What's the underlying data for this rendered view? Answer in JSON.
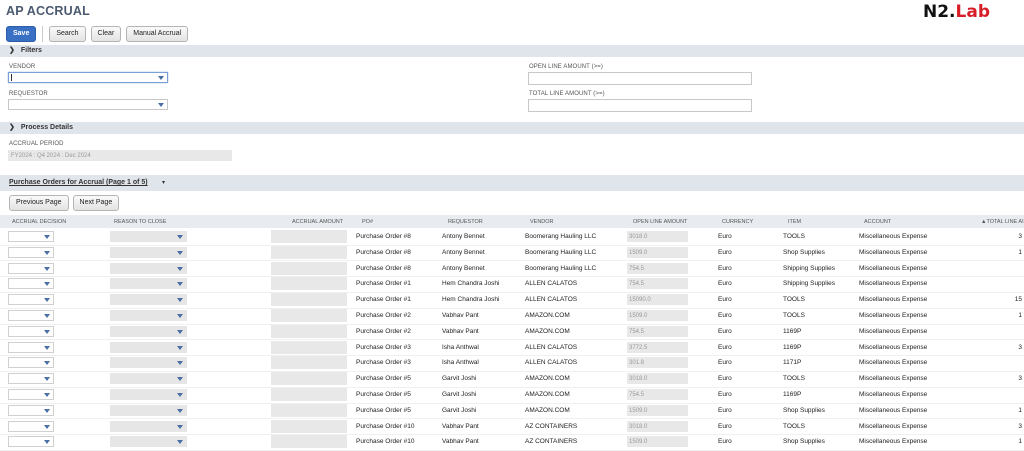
{
  "page": {
    "title": "AP ACCRUAL"
  },
  "logo": {
    "part1": "N2.",
    "part2": "Lab"
  },
  "buttons": {
    "save": "Save",
    "search": "Search",
    "clear": "Clear",
    "manual_accrual": "Manual Accrual"
  },
  "filters": {
    "header": "Filters",
    "vendor_label": "VENDOR",
    "requestor_label": "REQUESTOR",
    "open_line_amount_label": "OPEN LINE AMOUNT (>=)",
    "total_line_amount_label": "TOTAL LINE AMOUNT (>=)"
  },
  "process": {
    "header": "Process Details",
    "accrual_period_label": "ACCRUAL PERIOD",
    "accrual_period_value": "FY2024 : Q4 2024 : Dec 2024"
  },
  "sublist": {
    "title": "Purchase Orders for Accrual (Page 1 of 5)",
    "prev_label": "Previous Page",
    "next_label": "Next Page"
  },
  "columns": [
    "ACCRUAL DECISION",
    "REASON TO CLOSE",
    "ACCRUAL AMOUNT",
    "PO#",
    "REQUESTOR",
    "VENDOR",
    "OPEN LINE AMOUNT",
    "CURRENCY",
    "ITEM",
    "ACCOUNT",
    "▲TOTAL LINE AI"
  ],
  "rows": [
    {
      "po": "Purchase Order #8",
      "requestor": "Antony Bennet",
      "vendor": "Boomerang Hauling LLC",
      "open": "3018.0",
      "currency": "Euro",
      "item": "TOOLS",
      "account": "Miscellaneous Expense",
      "total": "3"
    },
    {
      "po": "Purchase Order #8",
      "requestor": "Antony Bennet",
      "vendor": "Boomerang Hauling LLC",
      "open": "1509.0",
      "currency": "Euro",
      "item": "Shop Supplies",
      "account": "Miscellaneous Expense",
      "total": "1"
    },
    {
      "po": "Purchase Order #8",
      "requestor": "Antony Bennet",
      "vendor": "Boomerang Hauling LLC",
      "open": "754.5",
      "currency": "Euro",
      "item": "Shipping Supplies",
      "account": "Miscellaneous Expense",
      "total": ""
    },
    {
      "po": "Purchase Order #1",
      "requestor": "Hem Chandra Joshi",
      "vendor": "ALLEN CALATOS",
      "open": "754.5",
      "currency": "Euro",
      "item": "Shipping Supplies",
      "account": "Miscellaneous Expense",
      "total": ""
    },
    {
      "po": "Purchase Order #1",
      "requestor": "Hem Chandra Joshi",
      "vendor": "ALLEN CALATOS",
      "open": "15090.0",
      "currency": "Euro",
      "item": "TOOLS",
      "account": "Miscellaneous Expense",
      "total": "15"
    },
    {
      "po": "Purchase Order #2",
      "requestor": "Vabhav Pant",
      "vendor": "AMAZON.COM",
      "open": "1509.0",
      "currency": "Euro",
      "item": "TOOLS",
      "account": "Miscellaneous Expense",
      "total": "1"
    },
    {
      "po": "Purchase Order #2",
      "requestor": "Vabhav Pant",
      "vendor": "AMAZON.COM",
      "open": "754.5",
      "currency": "Euro",
      "item": "1169P",
      "account": "Miscellaneous Expense",
      "total": ""
    },
    {
      "po": "Purchase Order #3",
      "requestor": "Isha Anthwal",
      "vendor": "ALLEN CALATOS",
      "open": "3772.5",
      "currency": "Euro",
      "item": "1169P",
      "account": "Miscellaneous Expense",
      "total": "3"
    },
    {
      "po": "Purchase Order #3",
      "requestor": "Isha Anthwal",
      "vendor": "ALLEN CALATOS",
      "open": "301.8",
      "currency": "Euro",
      "item": "1171P",
      "account": "Miscellaneous Expense",
      "total": ""
    },
    {
      "po": "Purchase Order #5",
      "requestor": "Garvit Joshi",
      "vendor": "AMAZON.COM",
      "open": "3018.0",
      "currency": "Euro",
      "item": "TOOLS",
      "account": "Miscellaneous Expense",
      "total": "3"
    },
    {
      "po": "Purchase Order #5",
      "requestor": "Garvit Joshi",
      "vendor": "AMAZON.COM",
      "open": "754.5",
      "currency": "Euro",
      "item": "1169P",
      "account": "Miscellaneous Expense",
      "total": ""
    },
    {
      "po": "Purchase Order #5",
      "requestor": "Garvit Joshi",
      "vendor": "AMAZON.COM",
      "open": "1509.0",
      "currency": "Euro",
      "item": "Shop Supplies",
      "account": "Miscellaneous Expense",
      "total": "1"
    },
    {
      "po": "Purchase Order #10",
      "requestor": "Vabhav Pant",
      "vendor": "AZ CONTAINERS",
      "open": "3018.0",
      "currency": "Euro",
      "item": "TOOLS",
      "account": "Miscellaneous Expense",
      "total": "3"
    },
    {
      "po": "Purchase Order #10",
      "requestor": "Vabhav Pant",
      "vendor": "AZ CONTAINERS",
      "open": "1509.0",
      "currency": "Euro",
      "item": "Shop Supplies",
      "account": "Miscellaneous Expense",
      "total": "1"
    }
  ]
}
